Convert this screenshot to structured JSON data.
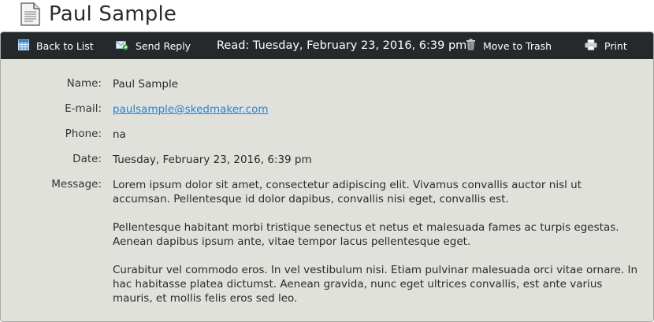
{
  "header": {
    "title": "Paul Sample",
    "icon": "document-icon"
  },
  "toolbar": {
    "back_label": "Back to List",
    "send_reply_label": "Send Reply",
    "read_status": "Read: Tuesday, February 23, 2016, 6:39 pm",
    "trash_label": "Move to Trash",
    "print_label": "Print",
    "background_color": "#26292c"
  },
  "message": {
    "name_label": "Name:",
    "name": "Paul Sample",
    "email_label": "E-mail:",
    "email": "paulsample@skedmaker.com",
    "phone_label": "Phone:",
    "phone": "na",
    "date_label": "Date:",
    "date": "Tuesday, February 23, 2016, 6:39 pm",
    "message_label": "Message:",
    "paragraphs": [
      "Lorem ipsum dolor sit amet, consectetur adipiscing elit. Vivamus convallis auctor nisl ut accumsan. Pellentesque id dolor dapibus, convallis nisi eget, convallis est.",
      "Pellentesque habitant morbi tristique senectus et netus et malesuada fames ac turpis egestas. Aenean dapibus ipsum ante, vitae tempor lacus pellentesque eget.",
      "Curabitur vel commodo eros. In vel vestibulum nisi. Etiam pulvinar malesuada orci vitae ornare. In hac habitasse platea dictumst. Aenean gravida, nunc eget ultrices convallis, est ante varius mauris, et mollis felis eros sed leo."
    ],
    "link_color": "#2f7fc0",
    "panel_color": "#e1e1dc"
  }
}
